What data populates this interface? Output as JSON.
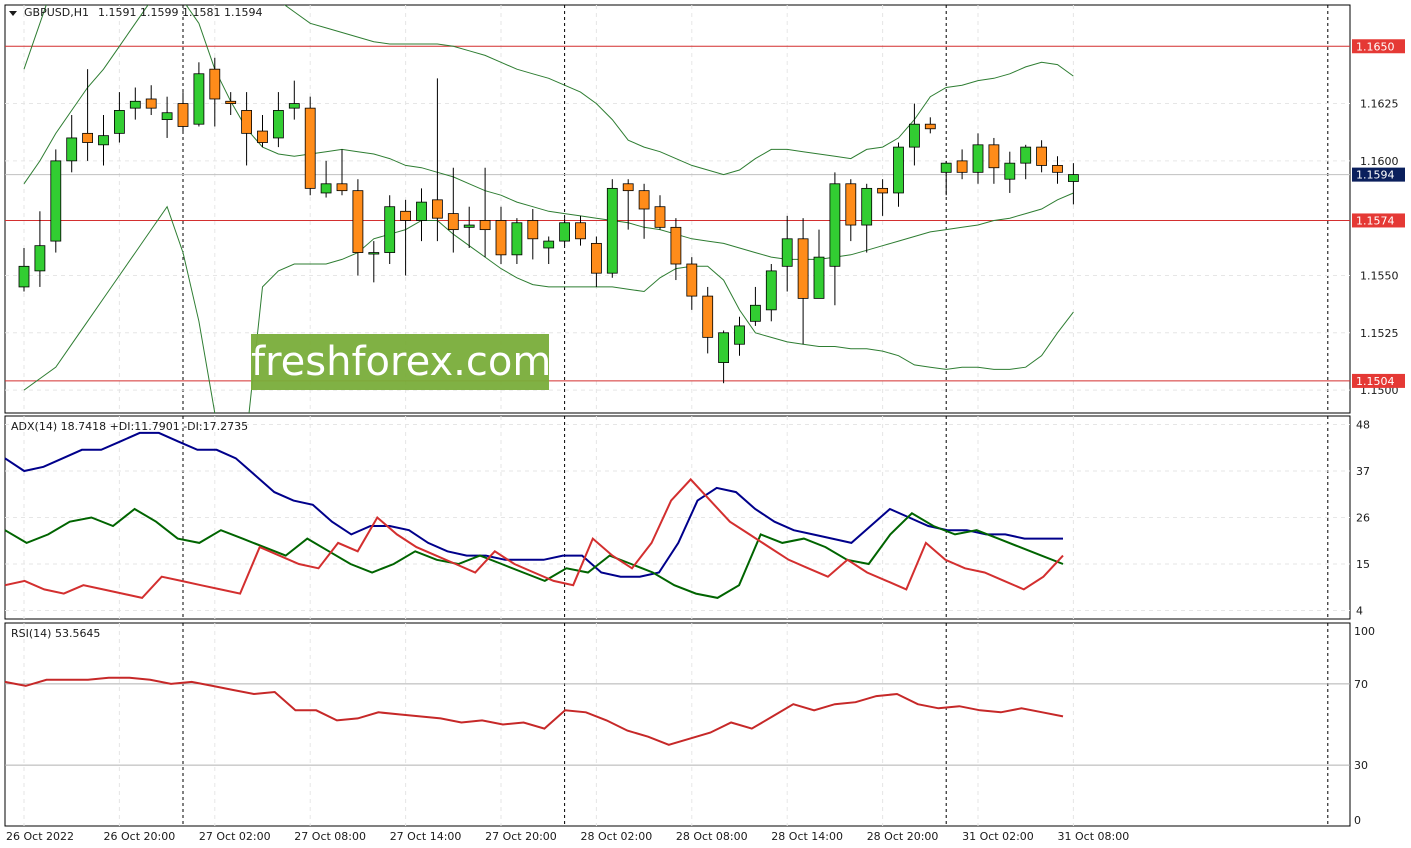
{
  "header": {
    "title": "GBPUSD,H1",
    "ohlc": "1.1591 1.1599 1.1581 1.1594"
  },
  "colors": {
    "bull": "#32cd32",
    "bear": "#ff8c1a",
    "bollinger": "#2e7d32",
    "adx": "#00008b",
    "plus_di": "#006400",
    "minus_di": "#d32f2f",
    "rsi": "#c62828",
    "level_line": "#d32f2f",
    "current_price_bg": "#0a1f5c",
    "level_label_bg": "#e53935"
  },
  "watermark": {
    "text": "freshforex.com"
  },
  "chart_data": [
    {
      "type": "candlestick",
      "title": "GBPUSD,H1",
      "ylim": [
        1.149,
        1.1668
      ],
      "y_ticks": [
        "1.1625",
        "1.1600",
        "1.1550",
        "1.1525",
        "1.1500"
      ],
      "x_tick_labels": [
        "26 Oct 2022",
        "26 Oct 20:00",
        "27 Oct 02:00",
        "27 Oct 08:00",
        "27 Oct 14:00",
        "27 Oct 20:00",
        "28 Oct 02:00",
        "28 Oct 08:00",
        "28 Oct 14:00",
        "28 Oct 20:00",
        "31 Oct 02:00",
        "31 Oct 08:00"
      ],
      "levels": [
        {
          "value": 1.165,
          "label": "1.1650"
        },
        {
          "value": 1.1574,
          "label": "1.1574"
        },
        {
          "value": 1.1504,
          "label": "1.1504"
        }
      ],
      "current_price": {
        "value": 1.1594,
        "label": "1.1594"
      },
      "candles": [
        [
          1.1545,
          1.1562,
          1.1543,
          1.1554
        ],
        [
          1.1552,
          1.1578,
          1.1545,
          1.1563
        ],
        [
          1.1565,
          1.1605,
          1.156,
          1.16
        ],
        [
          1.16,
          1.162,
          1.1595,
          1.161
        ],
        [
          1.1612,
          1.164,
          1.16,
          1.1608
        ],
        [
          1.1607,
          1.162,
          1.1598,
          1.1611
        ],
        [
          1.1612,
          1.163,
          1.1608,
          1.1622
        ],
        [
          1.1623,
          1.1632,
          1.1618,
          1.1626
        ],
        [
          1.1627,
          1.1633,
          1.162,
          1.1623
        ],
        [
          1.1618,
          1.1628,
          1.161,
          1.1621
        ],
        [
          1.1625,
          1.163,
          1.1612,
          1.1615
        ],
        [
          1.1616,
          1.1643,
          1.1615,
          1.1638
        ],
        [
          1.164,
          1.1645,
          1.1615,
          1.1627
        ],
        [
          1.1626,
          1.163,
          1.162,
          1.1625
        ],
        [
          1.1622,
          1.163,
          1.1598,
          1.1612
        ],
        [
          1.1613,
          1.162,
          1.1606,
          1.1608
        ],
        [
          1.161,
          1.163,
          1.1606,
          1.1622
        ],
        [
          1.1623,
          1.1635,
          1.1618,
          1.1625
        ],
        [
          1.1623,
          1.1628,
          1.1585,
          1.1588
        ],
        [
          1.1586,
          1.16,
          1.1584,
          1.159
        ],
        [
          1.159,
          1.1605,
          1.1585,
          1.1587
        ],
        [
          1.1587,
          1.1592,
          1.155,
          1.156
        ],
        [
          1.156,
          1.1565,
          1.1547,
          1.156
        ],
        [
          1.156,
          1.1585,
          1.1555,
          1.158
        ],
        [
          1.1578,
          1.1583,
          1.155,
          1.1574
        ],
        [
          1.1574,
          1.1588,
          1.1565,
          1.1582
        ],
        [
          1.1583,
          1.1636,
          1.1565,
          1.1575
        ],
        [
          1.1577,
          1.1597,
          1.156,
          1.157
        ],
        [
          1.1571,
          1.158,
          1.1562,
          1.1572
        ],
        [
          1.1574,
          1.1597,
          1.1558,
          1.157
        ],
        [
          1.1574,
          1.158,
          1.1555,
          1.1559
        ],
        [
          1.1559,
          1.1575,
          1.1555,
          1.1573
        ],
        [
          1.1574,
          1.1579,
          1.1557,
          1.1566
        ],
        [
          1.1562,
          1.1567,
          1.1555,
          1.1565
        ],
        [
          1.1565,
          1.1575,
          1.1563,
          1.1573
        ],
        [
          1.1573,
          1.1576,
          1.1563,
          1.1566
        ],
        [
          1.1564,
          1.1567,
          1.1545,
          1.1551
        ],
        [
          1.1551,
          1.1592,
          1.1549,
          1.1588
        ],
        [
          1.159,
          1.1592,
          1.157,
          1.1587
        ],
        [
          1.1587,
          1.159,
          1.1566,
          1.1579
        ],
        [
          1.158,
          1.1585,
          1.157,
          1.1571
        ],
        [
          1.1571,
          1.1575,
          1.1548,
          1.1555
        ],
        [
          1.1555,
          1.1558,
          1.1535,
          1.1541
        ],
        [
          1.1541,
          1.1545,
          1.1516,
          1.1523
        ],
        [
          1.1512,
          1.1526,
          1.1503,
          1.1525
        ],
        [
          1.152,
          1.1532,
          1.1515,
          1.1528
        ],
        [
          1.153,
          1.1545,
          1.1528,
          1.1537
        ],
        [
          1.1535,
          1.1555,
          1.153,
          1.1552
        ],
        [
          1.1554,
          1.1576,
          1.1543,
          1.1566
        ],
        [
          1.1566,
          1.1575,
          1.152,
          1.154
        ],
        [
          1.154,
          1.157,
          1.154,
          1.1558
        ],
        [
          1.1554,
          1.1595,
          1.1537,
          1.159
        ],
        [
          1.159,
          1.1592,
          1.1565,
          1.1572
        ],
        [
          1.1572,
          1.159,
          1.156,
          1.1588
        ],
        [
          1.1588,
          1.1592,
          1.1576,
          1.1586
        ],
        [
          1.1586,
          1.1608,
          1.158,
          1.1606
        ],
        [
          1.1606,
          1.1625,
          1.1598,
          1.1616
        ],
        [
          1.1616,
          1.1619,
          1.1612,
          1.1614
        ],
        [
          1.1595,
          1.16,
          1.1585,
          1.1599
        ],
        [
          1.16,
          1.1605,
          1.1592,
          1.1595
        ],
        [
          1.1595,
          1.1612,
          1.159,
          1.1607
        ],
        [
          1.1607,
          1.161,
          1.159,
          1.1597
        ],
        [
          1.1592,
          1.1604,
          1.1586,
          1.1599
        ],
        [
          1.1599,
          1.1607,
          1.1592,
          1.1606
        ],
        [
          1.1606,
          1.1609,
          1.1595,
          1.1598
        ],
        [
          1.1598,
          1.1602,
          1.159,
          1.1595
        ],
        [
          1.1591,
          1.1599,
          1.1581,
          1.1594
        ]
      ],
      "bollinger_upper": [
        1.164,
        1.166,
        1.168,
        1.17,
        1.1715,
        1.173,
        1.1745,
        1.176,
        1.177,
        1.178,
        1.177,
        1.1765,
        1.176,
        1.175,
        1.17,
        1.168,
        1.167,
        1.1665,
        1.166,
        1.1658,
        1.1656,
        1.1654,
        1.1652,
        1.1651,
        1.1651,
        1.1651,
        1.1651,
        1.165,
        1.1648,
        1.1646,
        1.1643,
        1.164,
        1.1638,
        1.1636,
        1.1633,
        1.163,
        1.1625,
        1.1618,
        1.1609,
        1.1606,
        1.1604,
        1.1601,
        1.1598,
        1.1596,
        1.1594,
        1.1596,
        1.1601,
        1.1605,
        1.1605,
        1.1604,
        1.1603,
        1.1602,
        1.1601,
        1.1605,
        1.1606,
        1.161,
        1.1618,
        1.1628,
        1.1632,
        1.1633,
        1.1635,
        1.1636,
        1.1638,
        1.1641,
        1.1643,
        1.1642,
        1.1637
      ],
      "bollinger_middle": [
        1.159,
        1.16,
        1.1612,
        1.1622,
        1.1632,
        1.164,
        1.165,
        1.166,
        1.167,
        1.168,
        1.167,
        1.166,
        1.164,
        1.1626,
        1.1614,
        1.1606,
        1.1603,
        1.1602,
        1.1603,
        1.1604,
        1.1605,
        1.1604,
        1.1603,
        1.1601,
        1.1598,
        1.1597,
        1.1595,
        1.1593,
        1.159,
        1.1587,
        1.1585,
        1.1582,
        1.158,
        1.1578,
        1.1577,
        1.1576,
        1.1575,
        1.1574,
        1.1573,
        1.1571,
        1.157,
        1.1568,
        1.1566,
        1.1565,
        1.1564,
        1.1562,
        1.156,
        1.1558,
        1.1557,
        1.1557,
        1.1557,
        1.1558,
        1.1559,
        1.1561,
        1.1563,
        1.1565,
        1.1567,
        1.1569,
        1.157,
        1.1571,
        1.1572,
        1.1574,
        1.1575,
        1.1577,
        1.1579,
        1.1583,
        1.1586
      ],
      "bollinger_lower": [
        1.15,
        1.1505,
        1.151,
        1.152,
        1.153,
        1.154,
        1.155,
        1.156,
        1.157,
        1.158,
        1.156,
        1.153,
        1.149,
        1.143,
        1.148,
        1.1545,
        1.1552,
        1.1555,
        1.1555,
        1.1555,
        1.1557,
        1.156,
        1.1566,
        1.1568,
        1.157,
        1.1574,
        1.1574,
        1.1568,
        1.1563,
        1.1558,
        1.1553,
        1.1549,
        1.1546,
        1.1545,
        1.1545,
        1.1545,
        1.1545,
        1.1545,
        1.1544,
        1.1543,
        1.1549,
        1.1553,
        1.1554,
        1.1554,
        1.1548,
        1.1535,
        1.1525,
        1.1523,
        1.1521,
        1.152,
        1.1519,
        1.1519,
        1.1518,
        1.1518,
        1.1517,
        1.1515,
        1.1511,
        1.151,
        1.1509,
        1.151,
        1.151,
        1.1509,
        1.1509,
        1.151,
        1.1515,
        1.1525,
        1.1534
      ]
    },
    {
      "type": "line",
      "title": "ADX(14) 18.7418 +DI:11.7901 -DI:17.2735",
      "ylim": [
        2,
        50
      ],
      "y_ticks": [
        "48",
        "37",
        "26",
        "15",
        "4"
      ],
      "series": [
        {
          "name": "ADX",
          "values": [
            40,
            37,
            38,
            40,
            42,
            42,
            44,
            46,
            46,
            44,
            42,
            42,
            40,
            36,
            32,
            30,
            29,
            25,
            22,
            24,
            24,
            23,
            20,
            18,
            17,
            17,
            16,
            16,
            16,
            17,
            17,
            13,
            12,
            12,
            13,
            20,
            30,
            33,
            32,
            28,
            25,
            23,
            22,
            21,
            20,
            24,
            28,
            26,
            24,
            23,
            23,
            22,
            22,
            21,
            21,
            21
          ]
        },
        {
          "name": "+DI",
          "values": [
            23,
            20,
            22,
            25,
            26,
            24,
            28,
            25,
            21,
            20,
            23,
            21,
            19,
            17,
            21,
            18,
            15,
            13,
            15,
            18,
            16,
            15,
            17,
            15,
            13,
            11,
            14,
            13,
            17,
            15,
            13,
            10,
            8,
            7,
            10,
            22,
            20,
            21,
            19,
            16,
            15,
            22,
            27,
            24,
            22,
            23,
            21,
            19,
            17,
            15
          ]
        },
        {
          "name": "-DI",
          "values": [
            10,
            11,
            9,
            8,
            10,
            9,
            8,
            7,
            12,
            11,
            10,
            9,
            8,
            19,
            17,
            15,
            14,
            20,
            18,
            26,
            22,
            19,
            17,
            15,
            13,
            18,
            15,
            13,
            11,
            10,
            21,
            17,
            14,
            20,
            30,
            35,
            30,
            25,
            22,
            19,
            16,
            14,
            12,
            16,
            13,
            11,
            9,
            20,
            16,
            14,
            13,
            11,
            9,
            12,
            17
          ]
        }
      ]
    },
    {
      "type": "line",
      "title": "RSI(14) 53.5645",
      "ylim": [
        0,
        100
      ],
      "y_ticks": [
        "100",
        "70",
        "30",
        "0"
      ],
      "levels": [
        70,
        30
      ],
      "series": [
        {
          "name": "RSI",
          "values": [
            71,
            69,
            72,
            72,
            72,
            73,
            73,
            72,
            70,
            71,
            69,
            67,
            65,
            66,
            57,
            57,
            52,
            53,
            56,
            55,
            54,
            53,
            51,
            52,
            50,
            51,
            48,
            57,
            56,
            52,
            47,
            44,
            40,
            43,
            46,
            51,
            48,
            54,
            60,
            57,
            60,
            61,
            64,
            65,
            60,
            58,
            59,
            57,
            56,
            58,
            56,
            54
          ]
        }
      ]
    }
  ]
}
